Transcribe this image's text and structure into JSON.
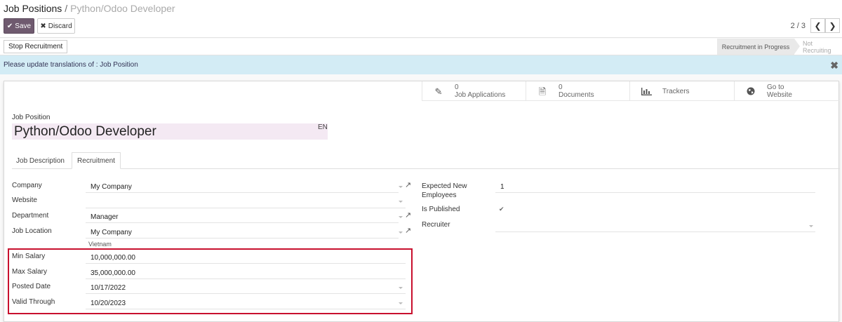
{
  "breadcrumb": {
    "parent": "Job Positions",
    "separator": "/",
    "current": "Python/Odoo Developer"
  },
  "toolbar": {
    "save_label": "Save",
    "discard_label": "Discard",
    "pager": "2 / 3"
  },
  "status": {
    "stop_label": "Stop Recruitment",
    "stages": [
      "Recruitment in Progress",
      "Not Recruiting"
    ]
  },
  "alert": {
    "text": "Please update translations of : Job Position"
  },
  "smart_buttons": [
    {
      "count": "0",
      "label": "Job Applications",
      "icon": "pencil-icon"
    },
    {
      "count": "0",
      "label": "Documents",
      "icon": "document-icon"
    },
    {
      "label": "Trackers",
      "icon": "bar-chart-icon"
    },
    {
      "line1": "Go to",
      "line2": "Website",
      "icon": "globe-icon"
    }
  ],
  "form": {
    "job_position_label": "Job Position",
    "job_name": "Python/Odoo Developer",
    "lang": "EN",
    "tabs": [
      "Job Description",
      "Recruitment"
    ],
    "left": {
      "company": {
        "label": "Company",
        "value": "My Company"
      },
      "website": {
        "label": "Website",
        "value": ""
      },
      "department": {
        "label": "Department",
        "value": "Manager"
      },
      "job_location": {
        "label": "Job Location",
        "value": "My Company",
        "sub": "Vietnam"
      },
      "min_salary": {
        "label": "Min Salary",
        "value": "10,000,000.00"
      },
      "max_salary": {
        "label": "Max Salary",
        "value": "35,000,000.00"
      },
      "posted_date": {
        "label": "Posted Date",
        "value": "10/17/2022"
      },
      "valid_through": {
        "label": "Valid Through",
        "value": "10/20/2023"
      }
    },
    "right": {
      "expected_new_employees": {
        "label_line1": "Expected New",
        "label_line2": "Employees",
        "value": "1"
      },
      "is_published": {
        "label": "Is Published",
        "checked": true
      },
      "recruiter": {
        "label": "Recruiter",
        "value": ""
      }
    }
  },
  "colors": {
    "save_button": "#6f5a6f",
    "alert_bg": "#d3ecf5",
    "name_bg": "#f4e9f3",
    "highlight": "#c8102e"
  }
}
